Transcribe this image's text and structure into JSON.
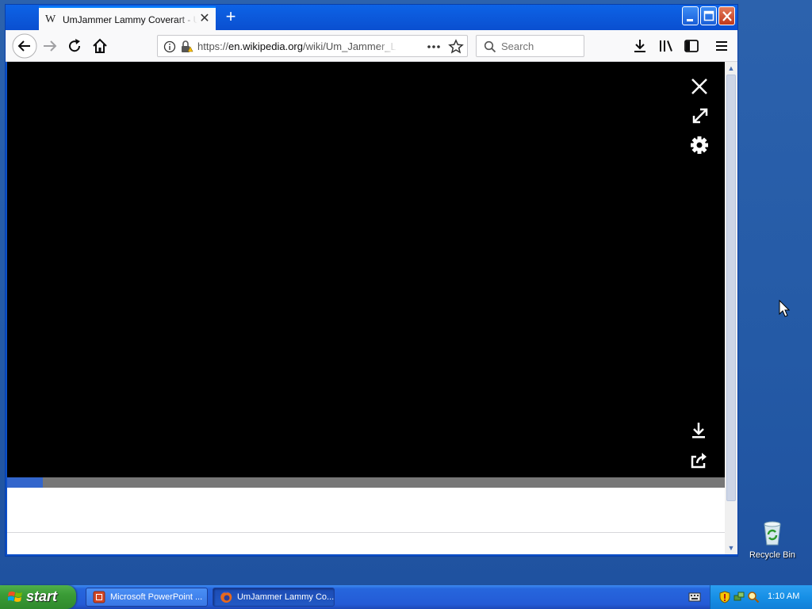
{
  "browser": {
    "tab": {
      "favicon": "W",
      "title": "UmJammer Lammy Coverart - Um..."
    },
    "url": {
      "scheme": "https://",
      "host": "en.wikipedia.org",
      "path": "/wiki/Um_Jammer_L"
    },
    "search_placeholder": "Search",
    "icons": [
      "back-icon",
      "forward-icon",
      "reload-icon",
      "home-icon",
      "info-icon",
      "lock-icon",
      "page-actions-icon",
      "bookmark-star-icon",
      "downloads-icon",
      "library-icon",
      "sidebar-icon",
      "menu-icon"
    ]
  },
  "viewer": {
    "icons": [
      "close-icon",
      "expand-icon",
      "settings-icon",
      "download-icon",
      "share-icon"
    ],
    "progress_fraction": 0.05
  },
  "desktop": {
    "recycle_bin_label": "Recycle Bin"
  },
  "taskbar": {
    "start_label": "start",
    "tasks": [
      {
        "label": "Microsoft PowerPoint ...",
        "active": false
      },
      {
        "label": "UmJammer Lammy Co...",
        "active": true
      }
    ],
    "clock": "1:10 AM"
  },
  "colors": {
    "desktop": "#245aa6",
    "titlebar": "#0a4fd0",
    "accent": "#0a84ff",
    "progress_fill": "#3366cc",
    "start_button": "#3a9b36"
  }
}
